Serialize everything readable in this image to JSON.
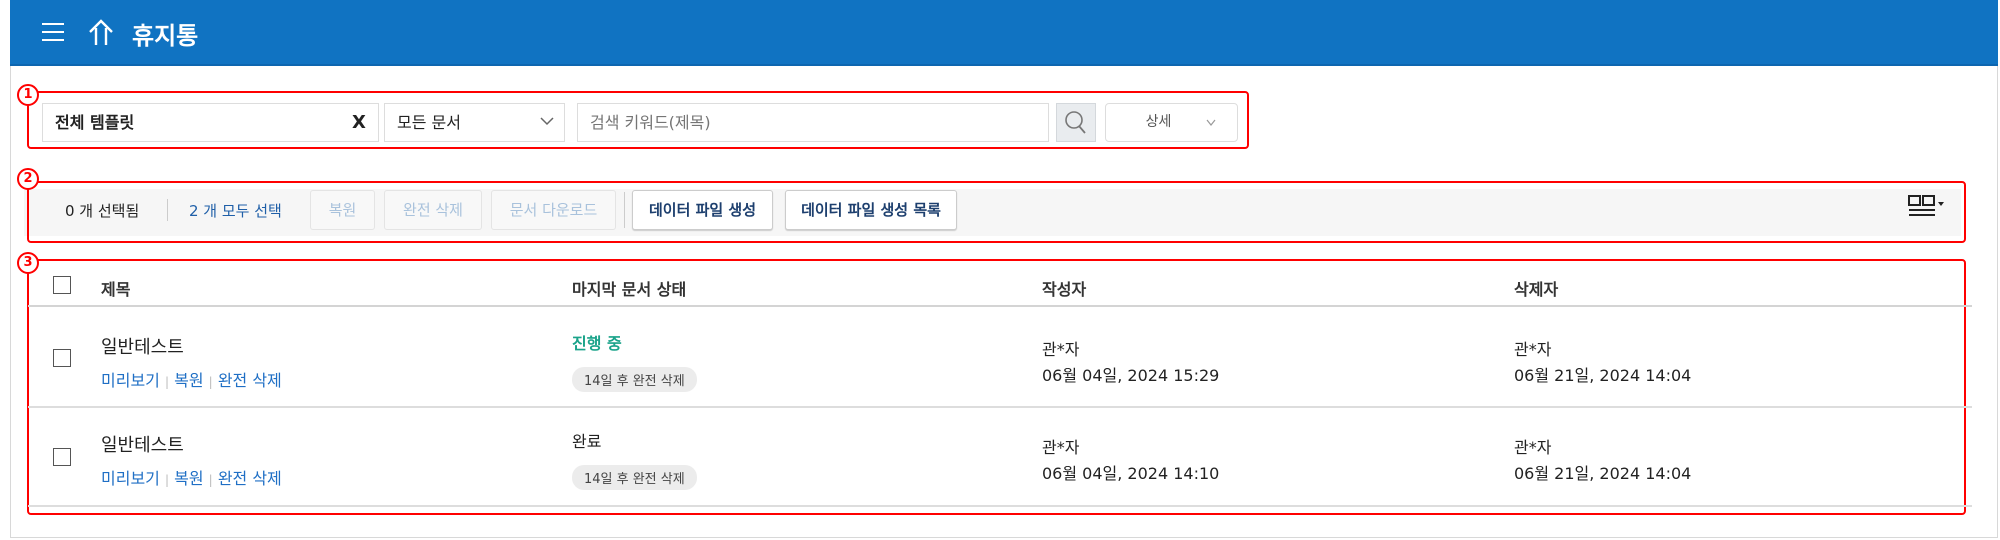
{
  "header": {
    "title": "휴지통",
    "menu_icon": "hamburger-icon",
    "home_icon": "home-icon",
    "bg_color": "#1073c2"
  },
  "annotations": [
    "1",
    "2",
    "3"
  ],
  "search": {
    "template_value": "전체 템플릿",
    "clear_label": "X",
    "doc_select": "모든 문서",
    "keyword_placeholder": "검색 키워드(제목)",
    "detail_label": "상세"
  },
  "toolbar": {
    "selected_count": "0 개 선택됨",
    "select_all": "2 개 모두 선택",
    "restore": "복원",
    "delete_permanent": "완전 삭제",
    "download": "문서 다운로드",
    "create_data_file": "데이터 파일 생성",
    "data_file_list": "데이터 파일 생성 목록",
    "view_icon": "column-view-icon"
  },
  "table": {
    "columns": [
      "제목",
      "마지막 문서 상태",
      "작성자",
      "삭제자"
    ],
    "rows": [
      {
        "title": "일반테스트",
        "actions": [
          "미리보기",
          "복원",
          "완전 삭제"
        ],
        "status": "진행 중",
        "status_color": "#1aa38a",
        "badge": "14일 후 완전 삭제",
        "author": "관*자",
        "author_date": "06월 04일, 2024 15:29",
        "deleter": "관*자",
        "deleter_date": "06월 21일, 2024 14:04"
      },
      {
        "title": "일반테스트",
        "actions": [
          "미리보기",
          "복원",
          "완전 삭제"
        ],
        "status": "완료",
        "status_color": "#222222",
        "badge": "14일 후 완전 삭제",
        "author": "관*자",
        "author_date": "06월 04일, 2024 14:10",
        "deleter": "관*자",
        "deleter_date": "06월 21일, 2024 14:04"
      }
    ]
  }
}
